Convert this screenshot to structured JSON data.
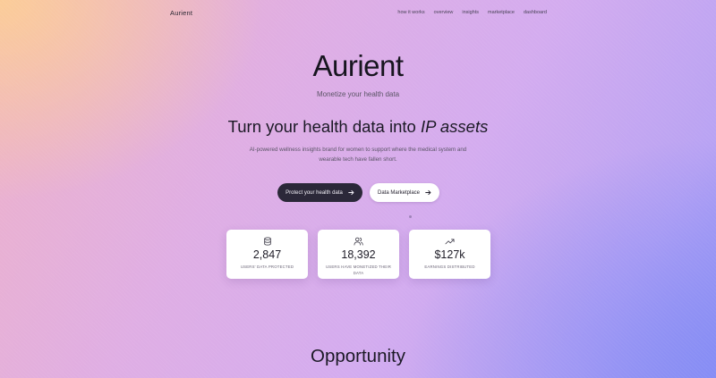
{
  "header": {
    "brand": "Aurient",
    "nav": [
      "how it works",
      "overview",
      "insights",
      "marketplace",
      "dashboard"
    ]
  },
  "hero": {
    "title": "Aurient",
    "subtitle": "Monetize your health data",
    "headline_plain": "Turn your health data into ",
    "headline_italic": "IP assets",
    "description": "AI-powered wellness insights brand for women to support where the medical system and wearable tech have fallen short."
  },
  "buttons": {
    "primary": "Protect your health data",
    "secondary": "Data Marketplace"
  },
  "stats": [
    {
      "icon": "database-icon",
      "value": "2,847",
      "label": "USERS' DATA PROTECTED"
    },
    {
      "icon": "users-icon",
      "value": "18,392",
      "label": "USERS HAVE MONETIZED THEIR DATA"
    },
    {
      "icon": "trending-up-icon",
      "value": "$127k",
      "label": "EARNINGS DISTRIBUTED"
    }
  ],
  "sections": {
    "opportunity_title": "Opportunity"
  },
  "colors": {
    "primary_button": "#2b2839",
    "text_dark": "#1d1b26",
    "gradient_start": "#fcce96",
    "gradient_mid": "#d4acef",
    "gradient_end": "#848cf5"
  }
}
